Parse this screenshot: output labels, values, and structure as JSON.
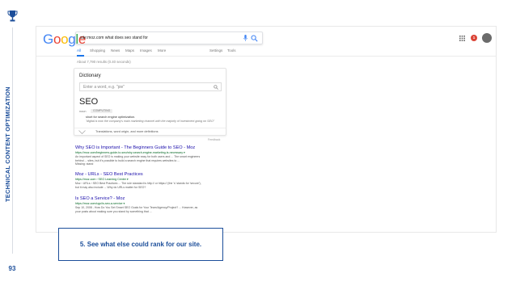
{
  "slide": {
    "vertical_title": "TECHNICAL CONTENT OPTIMIZATION",
    "page_number": "93",
    "accent_color": "#1c4e9a",
    "icon": "trophy-icon"
  },
  "google": {
    "logo": [
      "G",
      "o",
      "o",
      "g",
      "l",
      "e"
    ],
    "logo_colors": [
      "#4285f4",
      "#ea4335",
      "#fbbc05",
      "#4285f4",
      "#34a853",
      "#ea4335"
    ],
    "query": "site:moz.com what does seo stand for",
    "tabs": [
      {
        "label": "All"
      },
      {
        "label": "Shopping"
      },
      {
        "label": "News"
      },
      {
        "label": "Maps"
      },
      {
        "label": "Images"
      },
      {
        "label": "More"
      },
      {
        "label": "Settings"
      },
      {
        "label": "Tools"
      }
    ],
    "notification_count": "1",
    "stats": "About 7,790 results (0.40 seconds)"
  },
  "dictionary": {
    "heading": "Dictionary",
    "input_placeholder": "Enter a word, e.g. \"pie\"",
    "word": "SEO",
    "part_of_speech": "noun",
    "tag": "COMPUTING",
    "definition": "short for search engine optimization.",
    "example": "\"digital is now the company's main marketing channel with the majority of investment going on SEO\"",
    "more": "Translations, word origin, and more definitions",
    "feedback": "Feedback"
  },
  "results": [
    {
      "title": "Why SEO is Important - The Beginners Guide to SEO - Moz",
      "url": "https://moz.com/beginners-guide-to-seo/why-search-engine-marketing-is-necessary ▾",
      "snippet": [
        "An important aspect of SEO is making your website easy for both users and ... The smart engineers",
        "behind ... sites, but it's possible to build a search engine that requires websites to ...",
        "Missing: stand"
      ]
    },
    {
      "title": "Moz - URLs - SEO Best Practices",
      "url": "https://moz.com › SEO Learning Center ▾",
      "snippet": [
        "Moz › URLs › SEO Best Practices ... The rule standard is http:// or https:// (the 's' stands for 'secure'),",
        "but it may also include ... Why do URLs matter for SEO?"
      ]
    },
    {
      "title": "Is SEO a Service? - Moz",
      "url": "https://moz.com/ugc/is-seo-a-service ▾",
      "snippet": [
        "Sep 10, 2008 - How Do You Set Smart SEO Goals for Your Team/Agency/Project? ... However, as",
        "your posts about making sure you stand by something that ..."
      ]
    }
  ],
  "callout": {
    "text": "5. See what else could rank for our site."
  }
}
